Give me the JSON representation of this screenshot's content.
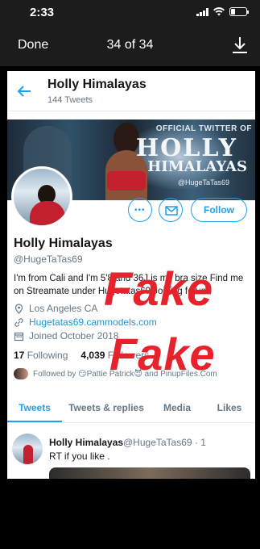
{
  "status_bar": {
    "time": "2:33"
  },
  "viewer": {
    "done_label": "Done",
    "counter": "34 of 34"
  },
  "profile": {
    "header_name": "Holly Himalayas",
    "tweet_count": "144 Tweets",
    "banner_text": {
      "official": "OFFICIAL TWITTER OF",
      "holly": "HOLLY",
      "himalayas": "HIMALAYAS",
      "handle": "@HugeTaTas69"
    },
    "follow_label": "Follow",
    "name": "Holly Himalayas",
    "handle": "@HugeTaTas69",
    "bio": "I'm from Cali and I'm 5'8 and 36J is my bra size Find me on Streamate under Hugetatas69 Joining forum.",
    "location": "Los Angeles CA",
    "link": "Hugetatas69.cammodels.com",
    "joined": "Joined October 2018",
    "following_count": "17",
    "following_label": "Following",
    "followers_count": "4,039",
    "followers_label": "Followers",
    "followed_by": "Followed by 😏Pattie Patrick😈 and PinupFiles.Com"
  },
  "tabs": [
    "Tweets",
    "Tweets & replies",
    "Media",
    "Likes"
  ],
  "tweet": {
    "name": "Holly Himalayas",
    "handle": "@HugeTaTas69 · 1",
    "text": "RT if you like ."
  },
  "overlay": {
    "word1": "Fake",
    "word2": "Fake"
  },
  "colors": {
    "accent": "#1da1f2",
    "overlay_red": "#e6232d"
  }
}
